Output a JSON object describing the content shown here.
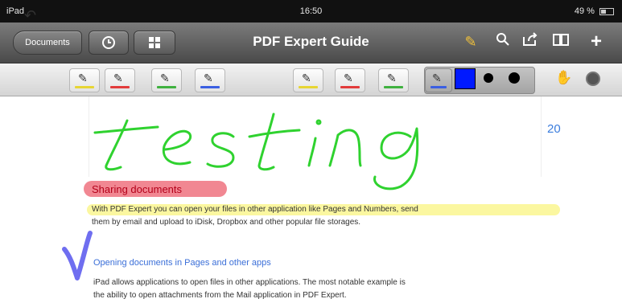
{
  "status_bar": {
    "device": "iPad",
    "time": "16:50",
    "battery": "49 %"
  },
  "nav_bar": {
    "back_label": "Documents",
    "title": "PDF Expert Guide",
    "icons": [
      "clock-icon",
      "grid-icon",
      "pen-icon",
      "search-icon",
      "share-icon",
      "book-icon",
      "plus-icon"
    ]
  },
  "toolbar": {
    "tools": [
      {
        "name": "highlighter-yellow",
        "stripe": "#e7d533"
      },
      {
        "name": "highlighter-red",
        "stripe": "#e23b3b"
      },
      {
        "name": "highlighter-green",
        "stripe": "#3fb13f"
      },
      {
        "name": "highlighter-blue",
        "stripe": "#3b5fe2"
      },
      {
        "name": "underline-yellow",
        "stripe": "#e7d533"
      },
      {
        "name": "underline-red",
        "stripe": "#e23b3b"
      },
      {
        "name": "underline-green",
        "stripe": "#3fb13f"
      },
      {
        "name": "pen-blue",
        "stripe": "#3b5fe2",
        "selected": true
      }
    ],
    "selected_color": "#0019ff"
  },
  "document": {
    "page_number": "20",
    "ink_text": "testing",
    "heading_1": "Sharing documents",
    "paragraph_1_line_1": "With PDF Expert you can open your files in other application like Pages and Numbers, send",
    "paragraph_1_line_2": "them by email and upload to iDisk, Dropbox and other popular file storages.",
    "heading_2": "Opening documents in Pages and other apps",
    "paragraph_2_line_1": "iPad allows applications to open files in other applications. The most notable example is",
    "paragraph_2_line_2": "the ability to open attachments from the Mail application in PDF Expert."
  },
  "colors": {
    "ink_green": "#2fd22f",
    "ink_blue": "#6f6ef0",
    "highlight_red": "#f07a86",
    "highlight_yellow": "#fbf7a0",
    "link_blue": "#3b6fd8"
  }
}
